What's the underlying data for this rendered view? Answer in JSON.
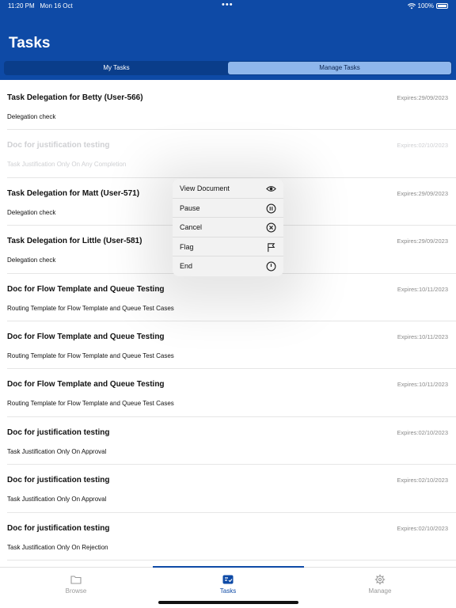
{
  "status_bar": {
    "time": "11:20 PM",
    "date": "Mon 16 Oct",
    "dots": "•••",
    "battery": "100%",
    "battery_level": 1.0
  },
  "header": {
    "title": "Tasks"
  },
  "segments": [
    {
      "label": "My Tasks",
      "active": false
    },
    {
      "label": "Manage Tasks",
      "active": true
    }
  ],
  "tasks": [
    {
      "title": "Task Delegation for Betty (User-566)",
      "subtitle": "Delegation check",
      "expires": "Expires:29/09/2023"
    },
    {
      "title": "Doc for justification testing",
      "subtitle": "Task Justification Only On Any Completion",
      "expires": "Expires:02/10/2023"
    },
    {
      "title": "Task Delegation for Matt (User-571)",
      "subtitle": "Delegation check",
      "expires": "Expires:29/09/2023"
    },
    {
      "title": "Task Delegation for Little (User-581)",
      "subtitle": "Delegation check",
      "expires": "Expires:29/09/2023"
    },
    {
      "title": "Doc for Flow Template and Queue Testing",
      "subtitle": "Routing Template for Flow Template and Queue Test Cases",
      "expires": "Expires:10/11/2023"
    },
    {
      "title": "Doc for Flow Template and Queue Testing",
      "subtitle": "Routing Template for Flow Template and Queue Test Cases",
      "expires": "Expires:10/11/2023"
    },
    {
      "title": "Doc for Flow Template and Queue Testing",
      "subtitle": "Routing Template for Flow Template and Queue Test Cases",
      "expires": "Expires:10/11/2023"
    },
    {
      "title": "Doc for justification testing",
      "subtitle": "Task Justification Only On Approval",
      "expires": "Expires:02/10/2023"
    },
    {
      "title": "Doc for justification testing",
      "subtitle": "Task Justification Only On Approval",
      "expires": "Expires:02/10/2023"
    },
    {
      "title": "Doc for justification testing",
      "subtitle": "Task Justification Only On Rejection",
      "expires": "Expires:02/10/2023"
    }
  ],
  "context_menu": {
    "items": [
      {
        "label": "View Document",
        "icon": "eye-icon"
      },
      {
        "label": "Pause",
        "icon": "pause-circle-icon"
      },
      {
        "label": "Cancel",
        "icon": "cancel-circle-icon"
      },
      {
        "label": "Flag",
        "icon": "flag-icon"
      },
      {
        "label": "End",
        "icon": "power-icon"
      }
    ]
  },
  "tabbar": {
    "tabs": [
      {
        "label": "Browse",
        "icon": "folder-icon",
        "active": false
      },
      {
        "label": "Tasks",
        "icon": "tasks-icon",
        "active": true
      },
      {
        "label": "Manage",
        "icon": "gear-icon",
        "active": false
      }
    ]
  },
  "colors": {
    "primary": "#0e4aa6",
    "segment_active": "#8fb7ec",
    "faded_text": "#cfd0d3"
  }
}
